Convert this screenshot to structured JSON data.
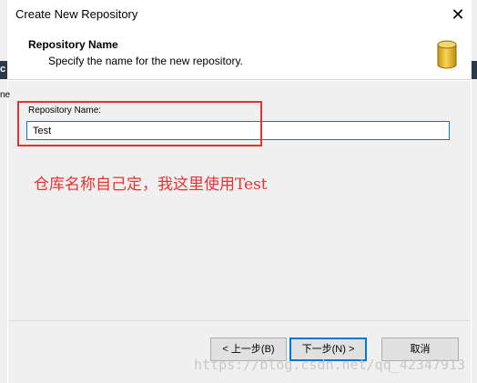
{
  "window": {
    "title": "Create New Repository",
    "close_glyph": "✕"
  },
  "header": {
    "title": "Repository Name",
    "description": "Specify the name for the new repository.",
    "icon": "database-icon"
  },
  "form": {
    "repository_name_label": "Repository Name:",
    "repository_name_value": "Test"
  },
  "annotation": {
    "text": "仓库名称自己定，我这里使用Test",
    "color": "#e53333"
  },
  "buttons": {
    "back": "< 上一步(B)",
    "next": "下一步(N) >",
    "cancel": "取消"
  },
  "watermark": "https://blog.csdn.net/qq_42347913",
  "background_window": {
    "fragment_1": "c",
    "fragment_2": "ne"
  },
  "colors": {
    "accent": "#0078d7",
    "annotation_red": "#e53333",
    "db_icon_gold": "#e8b91c"
  }
}
